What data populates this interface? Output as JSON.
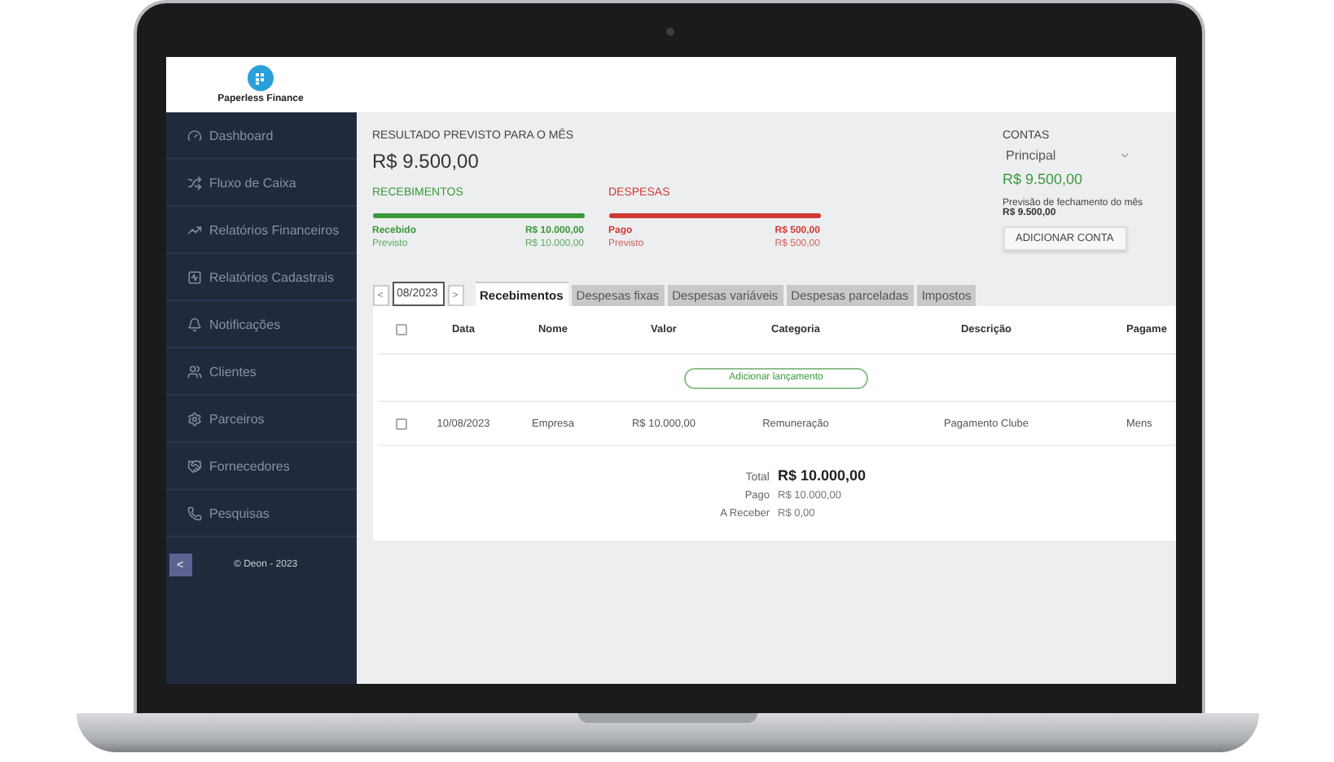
{
  "header": {
    "brand": "Paperless Finance"
  },
  "sidebar": {
    "items": [
      {
        "label": "Dashboard"
      },
      {
        "label": "Fluxo de Caixa"
      },
      {
        "label": "Relatórios Financeiros"
      },
      {
        "label": "Relatórios Cadastrais"
      },
      {
        "label": "Notificações"
      },
      {
        "label": "Clientes"
      },
      {
        "label": "Parceiros"
      },
      {
        "label": "Fornecedores"
      },
      {
        "label": "Pesquisas"
      }
    ],
    "collapse_button": "<",
    "footer": "© Deon - 2023"
  },
  "summary": {
    "title": "RESULTADO PREVISTO PARA O MÊS",
    "amount": "R$ 9.500,00",
    "groups": [
      {
        "title": "RECEBIMENTOS",
        "color": "#3a9a3a",
        "level": 1,
        "rows": [
          {
            "kind": "done",
            "label": "Recebido",
            "value": "R$ 10.000,00"
          },
          {
            "kind": "planned",
            "label": "Previsto",
            "value": "R$ 10.000,00"
          }
        ]
      },
      {
        "title": "DESPESAS",
        "color": "#cf3a34",
        "level": 1,
        "rows": [
          {
            "kind": "done",
            "label": "Pago",
            "value": "R$ 500,00"
          },
          {
            "kind": "planned",
            "label": "Previsto",
            "value": "R$ 500,00"
          }
        ]
      }
    ]
  },
  "accounts": {
    "title": "CONTAS",
    "selected_account": "Principal",
    "balance": "R$ 9.500,00",
    "forecast_label": "Previsão de fechamento do mês",
    "forecast_value": "R$ 9.500,00",
    "add_button": "ADICIONAR CONTA"
  },
  "period": {
    "prev": "<",
    "value": "08/2023",
    "next": ">"
  },
  "tabs": [
    {
      "label": "Recebimentos",
      "selected": true
    },
    {
      "label": "Despesas fixas",
      "selected": false
    },
    {
      "label": "Despesas variáveis",
      "selected": false
    },
    {
      "label": "Despesas parceladas",
      "selected": false
    },
    {
      "label": "Impostos",
      "selected": false
    }
  ],
  "table": {
    "select_all": {
      "checked": false
    },
    "columns": [
      "Data",
      "Nome",
      "Valor",
      "Categoria",
      "Descrição",
      "Pagame"
    ],
    "add_button": "Adicionar lançamento",
    "rows": [
      {
        "checked": false,
        "cells": [
          "10/08/2023",
          "Empresa",
          "R$ 10.000,00",
          "Remuneração",
          "Pagamento Clube",
          "Mens"
        ]
      }
    ]
  },
  "totals": [
    {
      "kind": "total",
      "label": "Total",
      "value": "R$ 10.000,00"
    },
    {
      "kind": "line",
      "label": "Pago",
      "value": "R$ 10.000,00"
    },
    {
      "kind": "line",
      "label": "A Receber",
      "value": "R$ 0,00"
    }
  ]
}
